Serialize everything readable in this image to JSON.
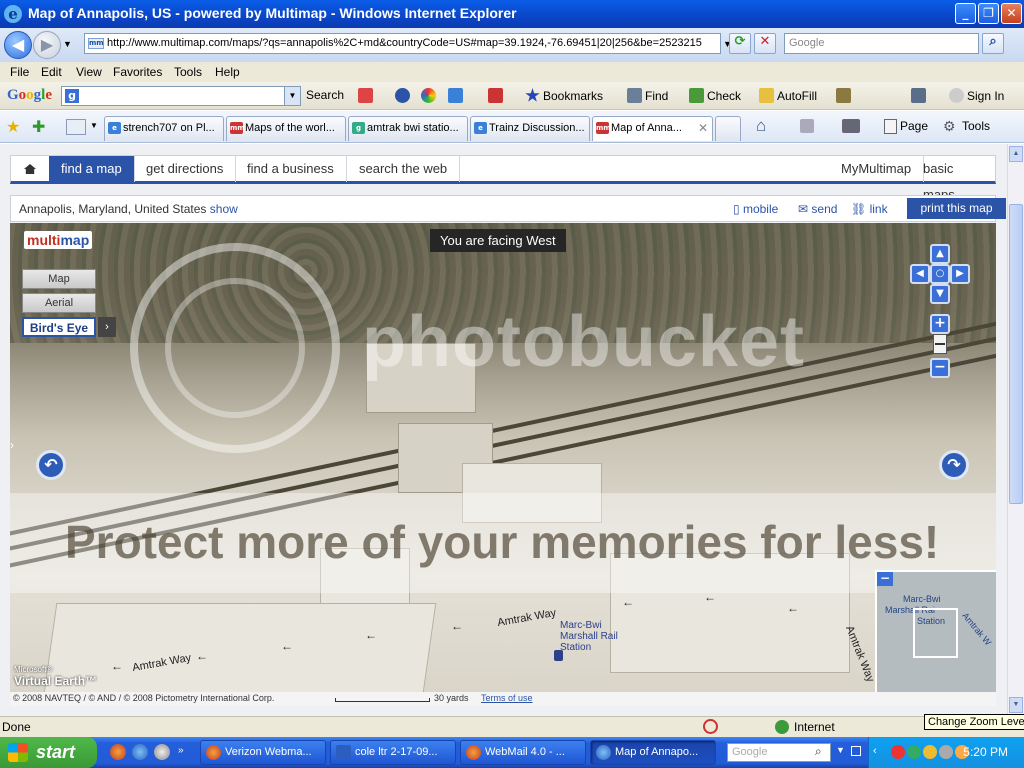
{
  "window": {
    "title": "Map of Annapolis, US - powered by Multimap - Windows Internet Explorer",
    "min": "_",
    "max": "❐",
    "close": "✕"
  },
  "address": {
    "url": "http://www.multimap.com/maps/?qs=annapolis%2C+md&countryCode=US#map=39.1924,-76.69451|20|256&be=2523215",
    "search_placeholder": "Google"
  },
  "menu": [
    "File",
    "Edit",
    "View",
    "Favorites",
    "Tools",
    "Help"
  ],
  "google_toolbar": {
    "logo": "Google",
    "search": "Search",
    "bookmarks": "Bookmarks",
    "find": "Find",
    "check": "Check",
    "autofill": "AutoFill",
    "signin": "Sign In"
  },
  "tabs": [
    {
      "label": "strench707 on Pl...",
      "active": false
    },
    {
      "label": "Maps of the worl...",
      "active": false
    },
    {
      "label": "amtrak bwi statio...",
      "active": false
    },
    {
      "label": "Trainz Discussion...",
      "active": false
    },
    {
      "label": "Map of Anna...",
      "active": true
    }
  ],
  "commands": {
    "page": "Page",
    "tools": "Tools"
  },
  "multimap": {
    "nav": [
      "find a map",
      "get directions",
      "find a business",
      "search the web"
    ],
    "right_nav": [
      "MyMultimap",
      "basic maps"
    ],
    "location": "Annapolis, Maryland, United States",
    "show": "show",
    "actions": {
      "mobile": "mobile",
      "send": "send",
      "link": "link",
      "print": "print this map"
    },
    "logo_a": "multi",
    "logo_b": "map",
    "facing": "You are facing West",
    "map_types": [
      "Map",
      "Aerial",
      "Bird's Eye"
    ],
    "pan": {
      "up": "▲",
      "left": "◀",
      "center": "○",
      "right": "▶",
      "down": "▼"
    },
    "zoom": {
      "in": "+",
      "out": "−"
    },
    "rotate_left": "↶",
    "rotate_right": "↷",
    "watermark_main": "photobucket",
    "watermark_sub": "Protect more of your memories for less!",
    "roads": [
      "Amtrak Way",
      "Amtrak Way",
      "Amtrak Way"
    ],
    "station": [
      "Marc-Bwi",
      "Marshall Rail",
      "Station"
    ],
    "minimap_labels": [
      "Marc-Bwi",
      "Marshall Rai",
      "Station",
      "Amtrak W"
    ],
    "virtual_earth_small": "Microsoft®",
    "virtual_earth": "Virtual Earth™",
    "attribution": "© 2008 NAVTEQ / © AND / © 2008 Pictometry International Corp.",
    "scale": "30 yards",
    "terms": "Terms of use"
  },
  "status": {
    "left": "Done",
    "zone": "Internet",
    "tooltip": "Change Zoom Level"
  },
  "taskbar": {
    "start": "start",
    "items": [
      {
        "label": "Verizon Webma...",
        "active": false
      },
      {
        "label": "cole ltr 2-17-09...",
        "active": false
      },
      {
        "label": "WebMail 4.0 - ...",
        "active": false
      },
      {
        "label": "Map of Annapo...",
        "active": true
      }
    ],
    "deskbar": "Google",
    "clock": "5:20 PM"
  }
}
